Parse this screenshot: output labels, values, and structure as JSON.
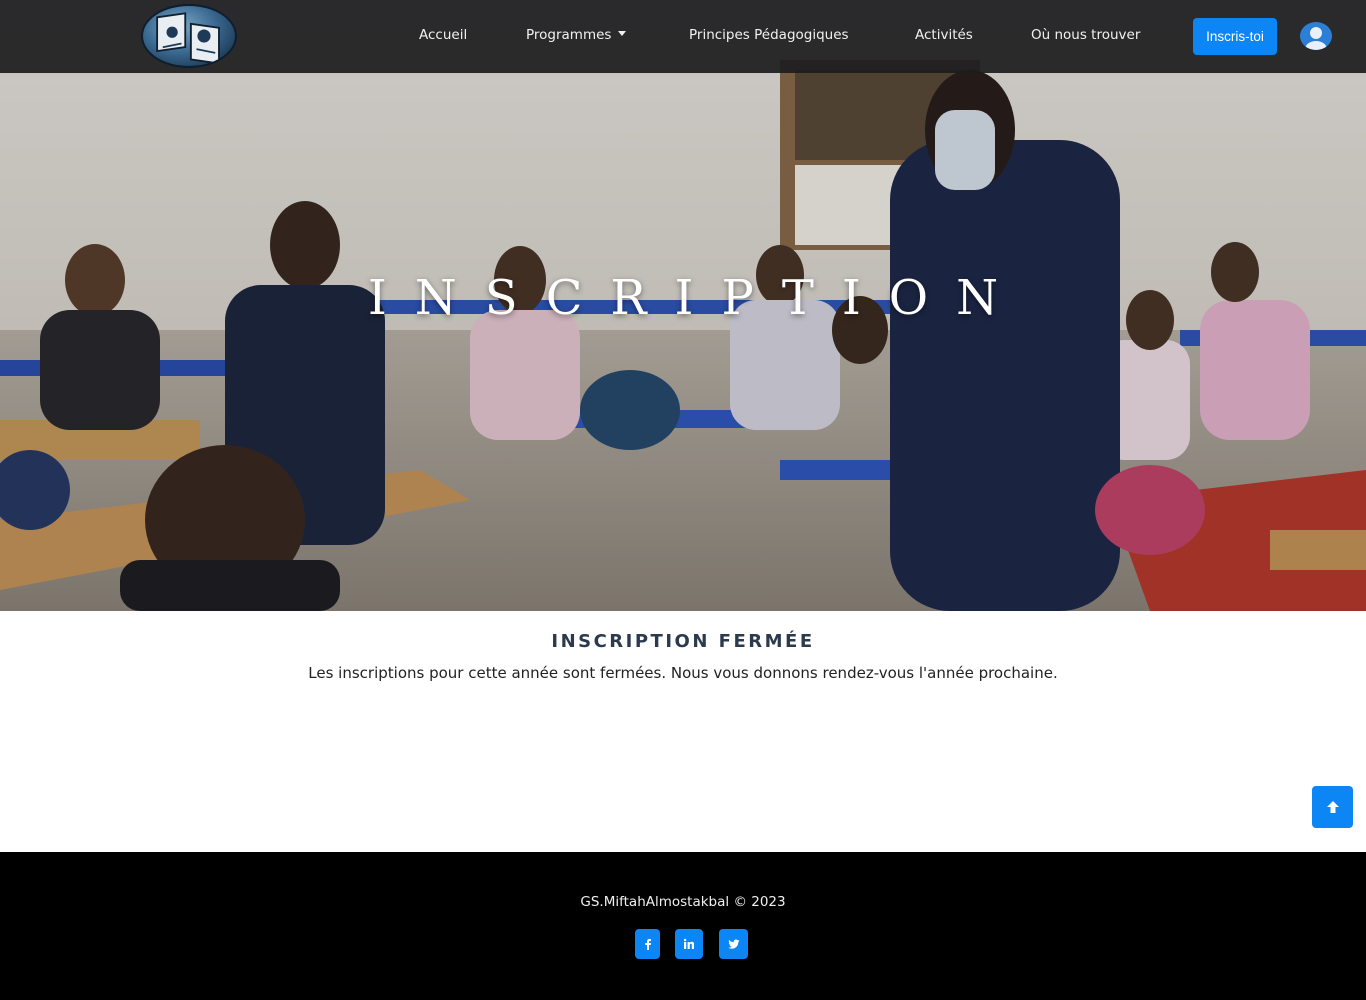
{
  "brand": {
    "logo_icon": "school-logo-icon"
  },
  "nav": {
    "items": [
      {
        "label": "Accueil"
      },
      {
        "label": "Programmes"
      },
      {
        "label": "Principes Pédagogiques"
      },
      {
        "label": "Activités"
      },
      {
        "label": "Où nous trouver"
      }
    ],
    "cta_label": "Inscris-toi",
    "user_icon": "user-avatar-icon"
  },
  "hero": {
    "title": "INSCRIPTION"
  },
  "main": {
    "heading": "INSCRIPTION FERMÉE",
    "message": "Les inscriptions pour cette année sont fermées. Nous vous donnons rendez-vous l'année prochaine."
  },
  "footer": {
    "copyright": "GS.MiftahAlmostakbal © 2023",
    "social": [
      {
        "icon": "facebook-icon"
      },
      {
        "icon": "linkedin-icon"
      },
      {
        "icon": "twitter-icon"
      }
    ]
  },
  "colors": {
    "accent": "#0d86f5",
    "navbar": "#1c1c1e",
    "footer": "#000000",
    "heading": "#2b3a4d"
  }
}
